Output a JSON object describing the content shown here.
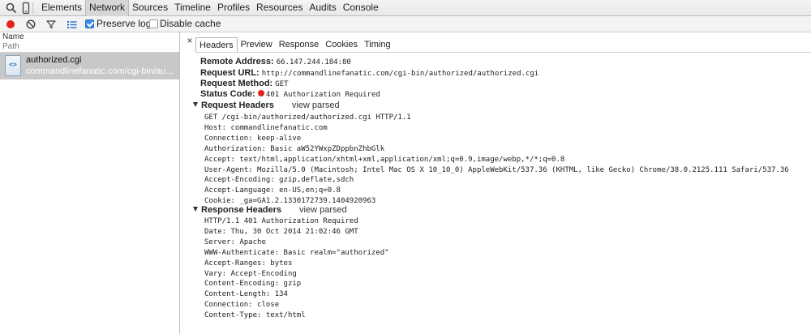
{
  "topbar": {
    "icons": [
      "search-icon",
      "device-icon"
    ],
    "tabs": [
      {
        "label": "Elements",
        "active": false
      },
      {
        "label": "Network",
        "active": true
      },
      {
        "label": "Sources",
        "active": false
      },
      {
        "label": "Timeline",
        "active": false
      },
      {
        "label": "Profiles",
        "active": false
      },
      {
        "label": "Resources",
        "active": false
      },
      {
        "label": "Audits",
        "active": false
      },
      {
        "label": "Console",
        "active": false
      }
    ]
  },
  "toolbar": {
    "icons": [
      "record-icon",
      "clear-icon",
      "filter-icon",
      "list-view-icon"
    ],
    "record_color": "#e0241b",
    "preserve_log": {
      "label": "Preserve log",
      "checked": true
    },
    "disable_cache": {
      "label": "Disable cache",
      "checked": false
    }
  },
  "request_list": {
    "columns": {
      "name": "Name",
      "path": "Path"
    },
    "items": [
      {
        "name": "authorized.cgi",
        "path": "commandlinefanatic.com/cgi-bin/au...",
        "icon": "html-file-icon",
        "icon_text": "<>"
      }
    ]
  },
  "details": {
    "close_glyph": "×",
    "tabs": [
      {
        "label": "Headers",
        "active": true
      },
      {
        "label": "Preview",
        "active": false
      },
      {
        "label": "Response",
        "active": false
      },
      {
        "label": "Cookies",
        "active": false
      },
      {
        "label": "Timing",
        "active": false
      }
    ],
    "general": [
      {
        "key": "Remote Address:",
        "value": "66.147.244.184:80"
      },
      {
        "key": "Request URL:",
        "value": "http://commandlinefanatic.com/cgi-bin/authorized/authorized.cgi"
      },
      {
        "key": "Request Method:",
        "value": "GET"
      },
      {
        "key": "Status Code:",
        "value": "401 Authorization Required",
        "status_color": "#e0241b"
      }
    ],
    "request_headers": {
      "title": "Request Headers",
      "toggle": "view parsed",
      "lines": [
        "GET /cgi-bin/authorized/authorized.cgi HTTP/1.1",
        "Host: commandlinefanatic.com",
        "Connection: keep-alive",
        "Authorization: Basic aW52YWxpZDppbnZhbGlk",
        "Accept: text/html,application/xhtml+xml,application/xml;q=0.9,image/webp,*/*;q=0.8",
        "User-Agent: Mozilla/5.0 (Macintosh; Intel Mac OS X 10_10_0) AppleWebKit/537.36 (KHTML, like Gecko) Chrome/38.0.2125.111 Safari/537.36",
        "Accept-Encoding: gzip,deflate,sdch",
        "Accept-Language: en-US,en;q=0.8",
        "Cookie: _ga=GA1.2.1330172739.1404920963"
      ]
    },
    "response_headers": {
      "title": "Response Headers",
      "toggle": "view parsed",
      "lines": [
        "HTTP/1.1 401 Authorization Required",
        "Date: Thu, 30 Oct 2014 21:02:46 GMT",
        "Server: Apache",
        "WWW-Authenticate: Basic realm=\"authorized\"",
        "Accept-Ranges: bytes",
        "Vary: Accept-Encoding",
        "Content-Encoding: gzip",
        "Content-Length: 134",
        "Connection: close",
        "Content-Type: text/html"
      ]
    }
  }
}
